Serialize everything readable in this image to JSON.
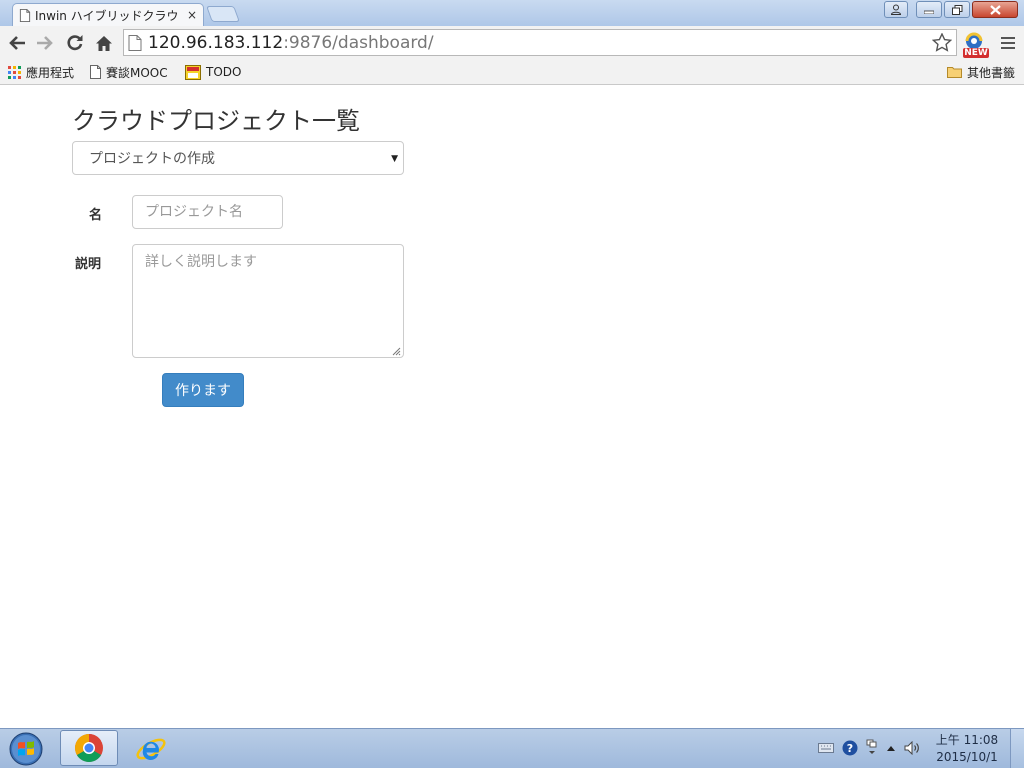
{
  "browser": {
    "tab_title": "Inwin ハイブリッドクラウ",
    "tab_close": "×",
    "url_host": "120.96.183.112",
    "url_path": ":9876/dashboard/",
    "ext_badge": "NEW"
  },
  "bookmarks": {
    "items": [
      {
        "label": "應用程式",
        "icon": "apps-grid-icon"
      },
      {
        "label": "賽談MOOC",
        "icon": "page-icon"
      },
      {
        "label": "TODO",
        "icon": "todo-icon"
      }
    ],
    "other": "其他書籤"
  },
  "page": {
    "title": "クラウドプロジェクト一覧",
    "select_value": "プロジェクトの作成",
    "name_label": "名",
    "name_placeholder": "プロジェクト名",
    "desc_label": "説明",
    "desc_placeholder": "詳しく説明します",
    "submit_label": "作ります"
  },
  "taskbar": {
    "time": "上午 11:08",
    "date": "2015/10/1"
  },
  "colors": {
    "primary": "#428bca",
    "primary_border": "#357ebd"
  }
}
